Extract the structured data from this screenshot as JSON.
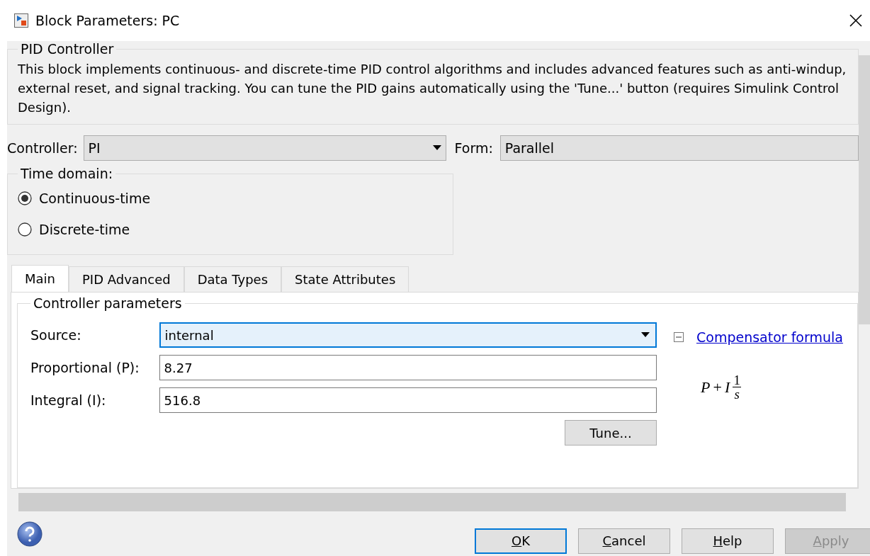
{
  "window": {
    "title": "Block Parameters: PC"
  },
  "description_group": {
    "title": "PID Controller",
    "text": "This block implements continuous- and discrete-time PID control algorithms and includes advanced features such as anti-windup, external reset, and signal tracking. You can tune the PID gains automatically using the 'Tune...' button (requires Simulink Control Design)."
  },
  "controller": {
    "label": "Controller:",
    "value": "PI"
  },
  "form": {
    "label": "Form:",
    "value": "Parallel"
  },
  "time_domain": {
    "title": "Time domain:",
    "options": [
      {
        "label": "Continuous-time",
        "selected": true
      },
      {
        "label": "Discrete-time",
        "selected": false
      }
    ]
  },
  "tabs": [
    {
      "label": "Main",
      "selected": true
    },
    {
      "label": "PID Advanced",
      "selected": false
    },
    {
      "label": "Data Types",
      "selected": false
    },
    {
      "label": "State Attributes",
      "selected": false
    }
  ],
  "controller_parameters": {
    "title": "Controller parameters",
    "fields": [
      {
        "kind": "dropdown",
        "label": "Source:",
        "value": "internal",
        "focused": true
      },
      {
        "kind": "text",
        "label": "Proportional (P):",
        "value": "8.27",
        "focused": false
      },
      {
        "kind": "text",
        "label": "Integral (I):",
        "value": "516.8",
        "focused": false
      }
    ],
    "tune_button": "Tune...",
    "formula_section": {
      "link": "Compensator formula",
      "expanded": true,
      "formula": {
        "p": "P",
        "plus": "+",
        "i": "I",
        "numerator": "1",
        "denominator": "s"
      }
    }
  },
  "buttons": [
    {
      "label": "OK",
      "default": true,
      "disabled": false
    },
    {
      "label": "Cancel",
      "default": false,
      "disabled": false
    },
    {
      "label": "Help",
      "default": false,
      "disabled": false
    },
    {
      "label": "Apply",
      "default": false,
      "disabled": true
    }
  ]
}
